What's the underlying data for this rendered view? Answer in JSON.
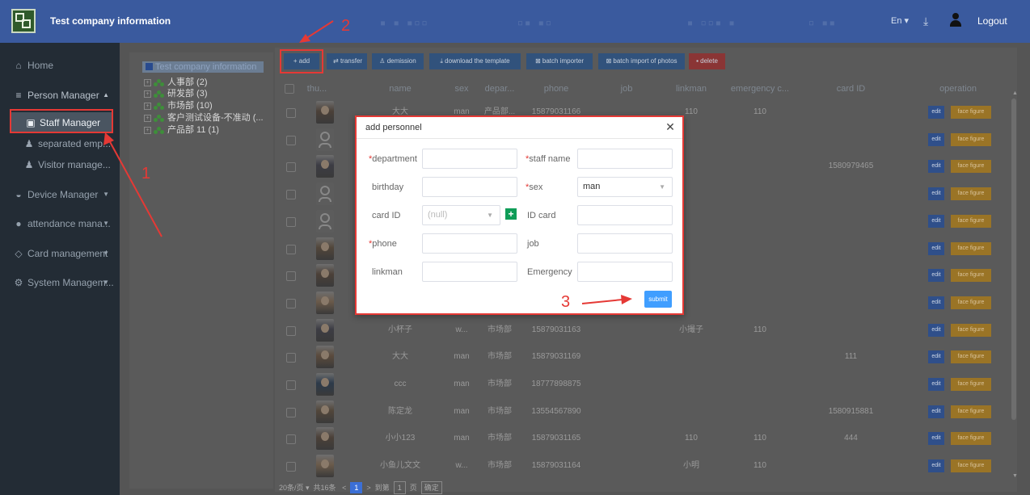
{
  "header": {
    "title": "Test company information",
    "language": "En ▾",
    "logout": "Logout",
    "icons": [
      "app-logo",
      "download-icon",
      "user-icon"
    ]
  },
  "sidebar": {
    "home": "Home",
    "person_manager": "Person Manager",
    "person_items": [
      "Staff Manager",
      "separated emp...",
      "Visitor manage..."
    ],
    "device_manager": "Device Manager",
    "attendance": "attendance mana...",
    "card_management": "Card management",
    "system_management": "System Managem..."
  },
  "toolbar": {
    "add": "+ add",
    "transfer": "transfer",
    "demission": "demission",
    "download_template": "download the template",
    "batch_importer": "batch importer",
    "batch_import_photos": "batch import of photos",
    "delete": "delete"
  },
  "tree": {
    "root": "Test company information",
    "nodes": [
      {
        "label": "人事部 (2)"
      },
      {
        "label": "研发部 (3)"
      },
      {
        "label": "市场部 (10)"
      },
      {
        "label": "客户测试设备-不准动 (..."
      },
      {
        "label": "产品部 11 (1)"
      }
    ]
  },
  "table": {
    "headers": [
      "thu...",
      "name",
      "sex",
      "depar...",
      "phone",
      "job",
      "linkman",
      "emergency c...",
      "card ID",
      "operation"
    ],
    "edit_label": "edit",
    "face_label": "face figure",
    "rows": [
      {
        "name": "大大",
        "sex": "man",
        "dept": "产品部...",
        "phone": "15879031166",
        "job": "",
        "linkman": "110",
        "emergency": "110",
        "card": "",
        "thumb": "photo"
      },
      {
        "name": "",
        "sex": "",
        "dept": "",
        "phone": "",
        "job": "",
        "linkman": "",
        "emergency": "",
        "card": "",
        "thumb": "avatar"
      },
      {
        "name": "",
        "sex": "",
        "dept": "",
        "phone": "",
        "job": "",
        "linkman": "",
        "emergency": "",
        "card": "1580979465",
        "thumb": "photo"
      },
      {
        "name": "",
        "sex": "",
        "dept": "",
        "phone": "",
        "job": "",
        "linkman": "",
        "emergency": "",
        "card": "",
        "thumb": "avatar"
      },
      {
        "name": "",
        "sex": "",
        "dept": "",
        "phone": "",
        "job": "",
        "linkman": "",
        "emergency": "",
        "card": "",
        "thumb": "avatar"
      },
      {
        "name": "",
        "sex": "",
        "dept": "",
        "phone": "",
        "job": "",
        "linkman": "",
        "emergency": "",
        "card": "",
        "thumb": "photo"
      },
      {
        "name": "",
        "sex": "",
        "dept": "",
        "phone": "",
        "job": "",
        "linkman": "",
        "emergency": "",
        "card": "",
        "thumb": "photo"
      },
      {
        "name": "",
        "sex": "",
        "dept": "",
        "phone": "",
        "job": "",
        "linkman": "",
        "emergency": "",
        "card": "",
        "thumb": "photo"
      },
      {
        "name": "小杯子",
        "sex": "w...",
        "dept": "市场部",
        "phone": "15879031163",
        "job": "",
        "linkman": "小撮子",
        "emergency": "110",
        "card": "",
        "thumb": "photo"
      },
      {
        "name": "大大",
        "sex": "man",
        "dept": "市场部",
        "phone": "15879031169",
        "job": "",
        "linkman": "",
        "emergency": "",
        "card": "111",
        "thumb": "photo"
      },
      {
        "name": "ccc",
        "sex": "man",
        "dept": "市场部",
        "phone": "18777898875",
        "job": "",
        "linkman": "",
        "emergency": "",
        "card": "",
        "thumb": "photo"
      },
      {
        "name": "陈定龙",
        "sex": "man",
        "dept": "市场部",
        "phone": "13554567890",
        "job": "",
        "linkman": "",
        "emergency": "",
        "card": "1580915881",
        "thumb": "photo"
      },
      {
        "name": "小小123",
        "sex": "man",
        "dept": "市场部",
        "phone": "15879031165",
        "job": "",
        "linkman": "110",
        "emergency": "110",
        "card": "444",
        "thumb": "photo"
      },
      {
        "name": "小鱼儿文文",
        "sex": "w...",
        "dept": "市场部",
        "phone": "15879031164",
        "job": "",
        "linkman": "小明",
        "emergency": "110",
        "card": "",
        "thumb": "photo"
      }
    ]
  },
  "pagination": {
    "per_page": "20条/页 ▾",
    "total": "共16条",
    "prev": "<",
    "current": "1",
    "next": ">",
    "goto_label": "到第",
    "goto_value": "1",
    "page_label": "页",
    "confirm": "确定"
  },
  "modal": {
    "title": "add personnel",
    "fields": {
      "department": "department",
      "staff_name": "staff name",
      "birthday": "birthday",
      "sex": "sex",
      "sex_value": "man",
      "card_id": "card ID",
      "card_id_value": "(null)",
      "id_card": "ID card",
      "phone": "phone",
      "job": "job",
      "linkman": "linkman",
      "emergency": "Emergency"
    },
    "submit": "submit"
  },
  "annotations": [
    "1",
    "2",
    "3"
  ],
  "colors": {
    "header": "#3a5a9e",
    "sidebar": "#232c35",
    "annotation": "#e53935",
    "submit": "#409eff",
    "face_button": "#9a7426"
  }
}
